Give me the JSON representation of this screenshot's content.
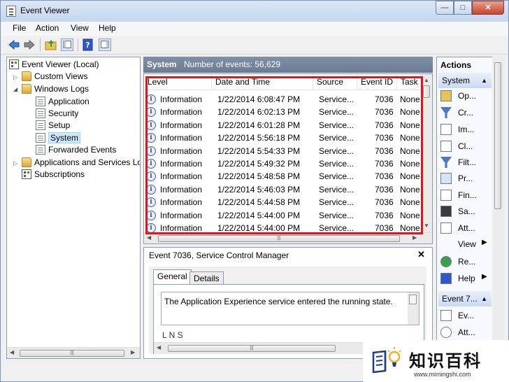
{
  "window": {
    "title": "Event Viewer"
  },
  "menu": [
    "File",
    "Action",
    "View",
    "Help"
  ],
  "tree": {
    "root": "Event Viewer (Local)",
    "custom_views": "Custom Views",
    "windows_logs": "Windows Logs",
    "logs": [
      "Application",
      "Security",
      "Setup",
      "System",
      "Forwarded Events"
    ],
    "apps_services": "Applications and Services Lo",
    "subscriptions": "Subscriptions"
  },
  "center": {
    "log_name": "System",
    "event_count": "Number of events: 56,629",
    "columns": [
      "Level",
      "Date and Time",
      "Source",
      "Event ID",
      "Task"
    ],
    "rows": [
      {
        "level": "Information",
        "date": "1/22/2014 6:08:47 PM",
        "source": "Service...",
        "id": "7036",
        "task": "None"
      },
      {
        "level": "Information",
        "date": "1/22/2014 6:02:13 PM",
        "source": "Service...",
        "id": "7036",
        "task": "None"
      },
      {
        "level": "Information",
        "date": "1/22/2014 6:01:28 PM",
        "source": "Service...",
        "id": "7036",
        "task": "None"
      },
      {
        "level": "Information",
        "date": "1/22/2014 5:56:18 PM",
        "source": "Service...",
        "id": "7036",
        "task": "None"
      },
      {
        "level": "Information",
        "date": "1/22/2014 5:54:33 PM",
        "source": "Service...",
        "id": "7036",
        "task": "None"
      },
      {
        "level": "Information",
        "date": "1/22/2014 5:49:32 PM",
        "source": "Service...",
        "id": "7036",
        "task": "None"
      },
      {
        "level": "Information",
        "date": "1/22/2014 5:48:58 PM",
        "source": "Service...",
        "id": "7036",
        "task": "None"
      },
      {
        "level": "Information",
        "date": "1/22/2014 5:46:03 PM",
        "source": "Service...",
        "id": "7036",
        "task": "None"
      },
      {
        "level": "Information",
        "date": "1/22/2014 5:44:58 PM",
        "source": "Service...",
        "id": "7036",
        "task": "None"
      },
      {
        "level": "Information",
        "date": "1/22/2014 5:44:00 PM",
        "source": "Service...",
        "id": "7036",
        "task": "None"
      },
      {
        "level": "Information",
        "date": "1/22/2014 5:44:00 PM",
        "source": "Service...",
        "id": "7036",
        "task": "None"
      }
    ]
  },
  "detail": {
    "title": "Event 7036, Service Control Manager",
    "tabs": [
      "General",
      "Details"
    ],
    "message": "The Application Experience service entered the running state.",
    "partial_line": "L  N              S"
  },
  "actions": {
    "header": "Actions",
    "section1": "System",
    "items1": [
      "Op...",
      "Cr...",
      "Im...",
      "Cl...",
      "Filt...",
      "Pr...",
      "Fin...",
      "Sa...",
      "Att...",
      "View",
      "Re...",
      "Help"
    ],
    "section2": "Event 7...",
    "items2": [
      "Ev...",
      "Att..."
    ]
  },
  "watermark": {
    "text": "知识百科",
    "url": "www.mimingshi.com"
  },
  "colors": {
    "highlight": "#e3141b",
    "header": "#6a7a92",
    "selection": "#cce8ff"
  }
}
